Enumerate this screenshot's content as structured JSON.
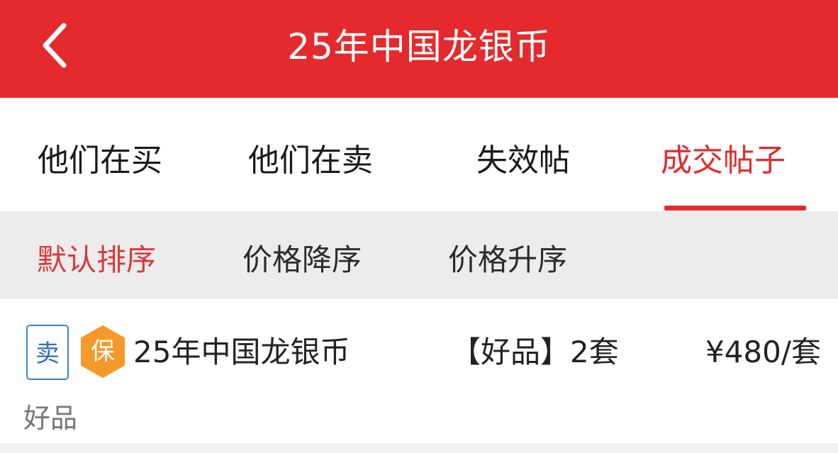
{
  "header": {
    "title": "25年中国龙银币",
    "back_icon": "chevron-left-icon",
    "background_color": "#e42a2d"
  },
  "tabs": [
    {
      "label": "他们在买",
      "active": false
    },
    {
      "label": "他们在卖",
      "active": false
    },
    {
      "label": "失效帖",
      "active": false
    },
    {
      "label": "成交帖子",
      "active": true
    }
  ],
  "sort_options": [
    {
      "label": "默认排序",
      "active": true
    },
    {
      "label": "价格降序",
      "active": false
    },
    {
      "label": "价格升序",
      "active": false
    }
  ],
  "listings": [
    {
      "type_badge": "卖",
      "guarantee_badge": "保",
      "name": "25年中国龙银币",
      "quantity": "【好品】2套",
      "price": "¥480/套",
      "condition": "好品"
    }
  ],
  "colors": {
    "accent": "#e42a2d",
    "sell_badge": "#3b82c9",
    "guarantee_badge": "#f39a2b"
  }
}
